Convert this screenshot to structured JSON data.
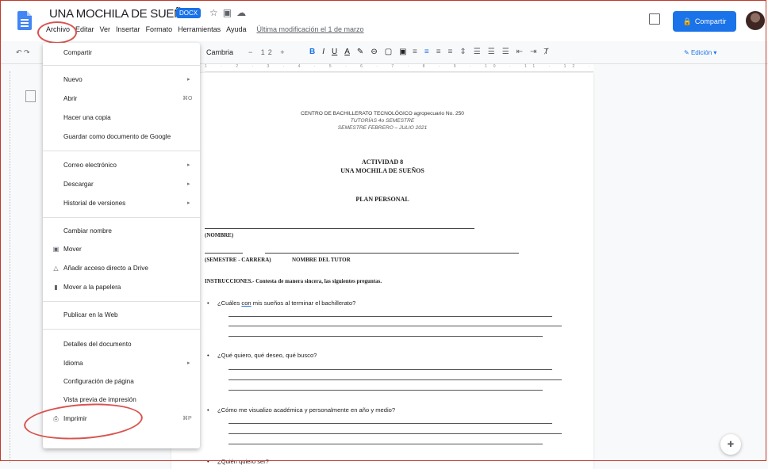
{
  "doc": {
    "title": "UNA MOCHILA DE SUEÑOS",
    "badge": "DOCX",
    "last_edit": "Última modificación el 1 de marzo",
    "share_label": "Compartir"
  },
  "menubar": [
    "Archivo",
    "Editar",
    "Ver",
    "Insertar",
    "Formato",
    "Herramientas",
    "Ayuda"
  ],
  "toolbar": {
    "font": "Cambria",
    "font_size": "12",
    "mode": "Edición"
  },
  "file_menu": {
    "items": [
      {
        "label": "Compartir"
      },
      {
        "label": "Nuevo",
        "submenu": true
      },
      {
        "label": "Abrir",
        "shortcut": "⌘O"
      },
      {
        "label": "Hacer una copia"
      },
      {
        "label": "Guardar como documento de Google"
      },
      {
        "label": "Correo electrónico",
        "submenu": true
      },
      {
        "label": "Descargar",
        "submenu": true
      },
      {
        "label": "Historial de versiones",
        "submenu": true
      },
      {
        "label": "Cambiar nombre"
      },
      {
        "label": "Mover",
        "icon": "folder-move-icon"
      },
      {
        "label": "Añadir acceso directo a Drive",
        "icon": "drive-shortcut-icon"
      },
      {
        "label": "Mover a la papelera",
        "icon": "trash-icon"
      },
      {
        "label": "Publicar en la Web"
      },
      {
        "label": "Detalles del documento"
      },
      {
        "label": "Idioma",
        "submenu": true
      },
      {
        "label": "Configuración de página"
      },
      {
        "label": "Vista previa de impresión"
      },
      {
        "label": "Imprimir",
        "shortcut": "⌘P",
        "icon": "printer-icon"
      }
    ]
  },
  "page": {
    "header1": "CENTRO DE BACHILLERATO TECNOLÓGICO agropecuario No. 250",
    "header2": "TUTORÍAS 4o SEMESTRE",
    "header3": "SEMESTRE FEBRERO – JULIO 2021",
    "activity": "ACTIVIDAD 8",
    "activity_title": "UNA MOCHILA DE SUEÑOS",
    "plan": "PLAN PERSONAL",
    "name_label": "(NOMBRE)",
    "semester_label": "(SEMESTRE - CARRERA)",
    "tutor_label": "NOMBRE DEL TUTOR",
    "instructions_bold": "INSTRUCCIONES.-",
    "instructions_text": "Contesta de manera sincera, las siguientes preguntas.",
    "q1_a": "¿Cuáles",
    "q1_b": "con",
    "q1_c": "mis sueños al terminar el bachillerato?",
    "q2": "¿Qué quiero, qué deseo, qué busco?",
    "q3": "¿Cómo me visualizo académica y personalmente en año y medio?",
    "q4": "¿Quién quiero ser?"
  },
  "colors": {
    "accent": "#1a73e8",
    "annotation": "#d9534f"
  }
}
